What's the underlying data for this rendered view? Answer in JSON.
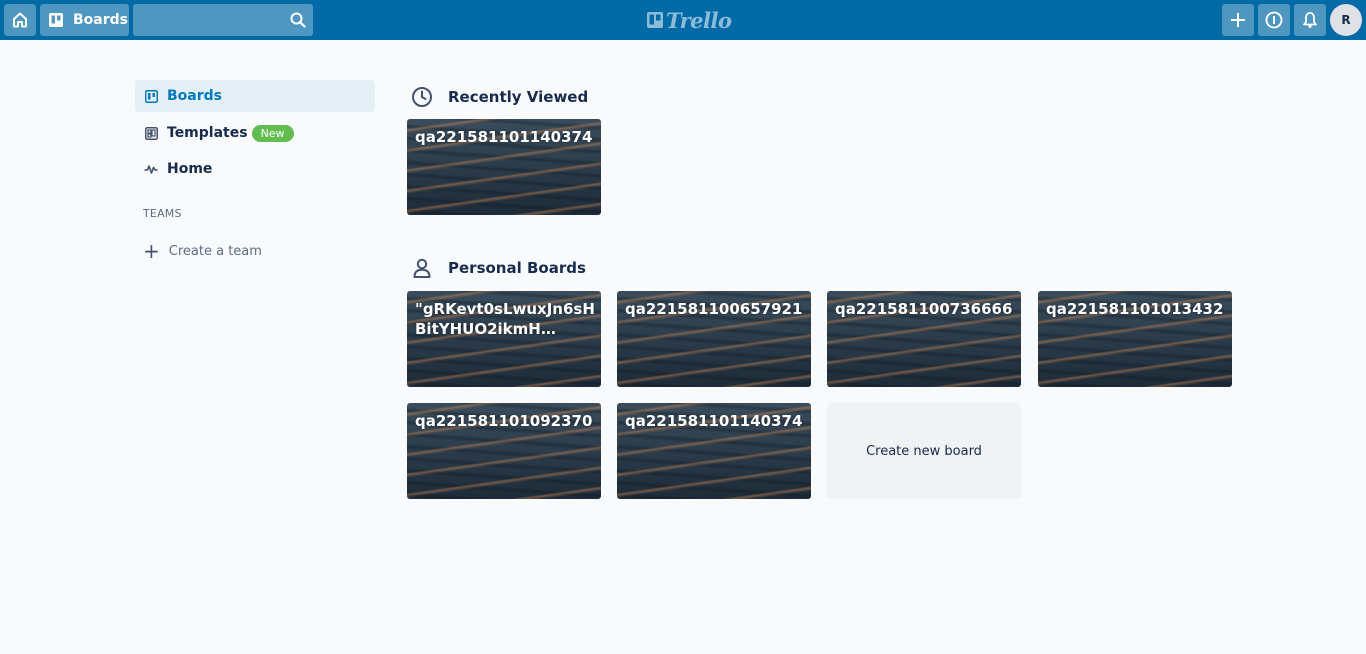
{
  "header": {
    "boards_label": "Boards",
    "search_value": "",
    "logo_text": "Trello",
    "avatar_initial": "R"
  },
  "sidebar": {
    "items": [
      {
        "label": "Boards",
        "icon": "board-icon",
        "active": true
      },
      {
        "label": "Templates",
        "icon": "template-icon",
        "badge": "New"
      },
      {
        "label": "Home",
        "icon": "activity-icon"
      }
    ],
    "teams_heading": "TEAMS",
    "create_team_label": "Create a team"
  },
  "recent": {
    "title": "Recently Viewed",
    "icon": "clock-icon",
    "boards": [
      "qa221581101140374"
    ]
  },
  "personal": {
    "title": "Personal Boards",
    "icon": "person-icon",
    "boards": [
      "\"gRKevt0sLwuxJn6sHBitYHUO2ikmH…",
      "qa221581100657921",
      "qa221581100736666",
      "qa221581101013432",
      "qa221581101092370",
      "qa221581101140374"
    ],
    "create_label": "Create new board"
  },
  "colors": {
    "header_bg": "#026aa7",
    "active_bg": "#e4f0f6",
    "active_text": "#0079bf",
    "badge_bg": "#61bd4f"
  }
}
